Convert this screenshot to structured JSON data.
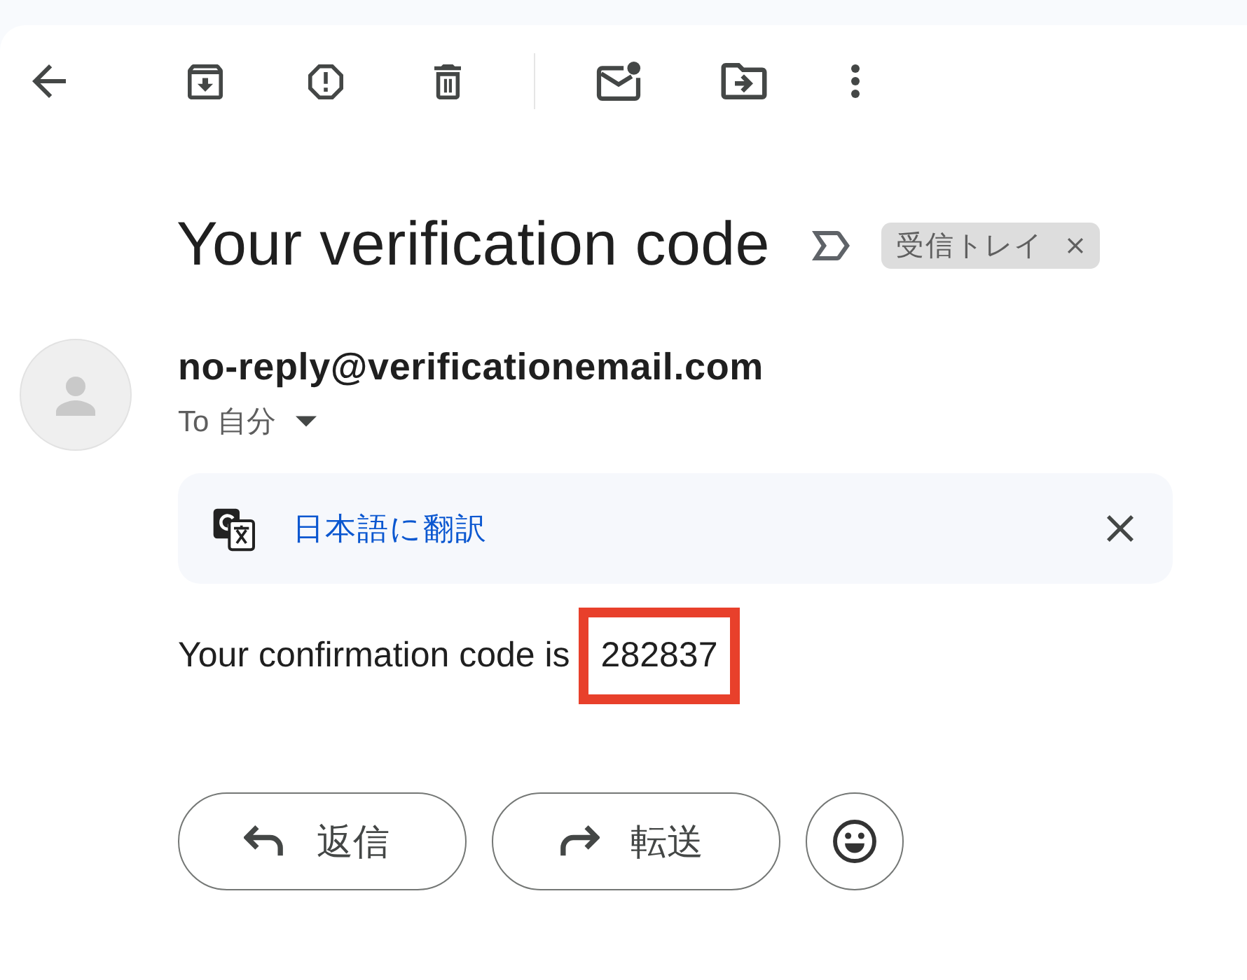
{
  "subject": {
    "title": "Your verification code",
    "labels": [
      {
        "text": "受信トレイ"
      }
    ]
  },
  "message": {
    "sender": "no-reply@verificationemail.com",
    "recipient": "To 自分"
  },
  "translate_bar": {
    "link": "日本語に翻訳"
  },
  "body": {
    "text": "Your confirmation code is",
    "code": "282837",
    "code_highlighted": true
  },
  "actions": [
    {
      "kind": "reply",
      "label": "返信"
    },
    {
      "kind": "forward",
      "label": "転送"
    },
    {
      "kind": "emoji"
    }
  ]
}
